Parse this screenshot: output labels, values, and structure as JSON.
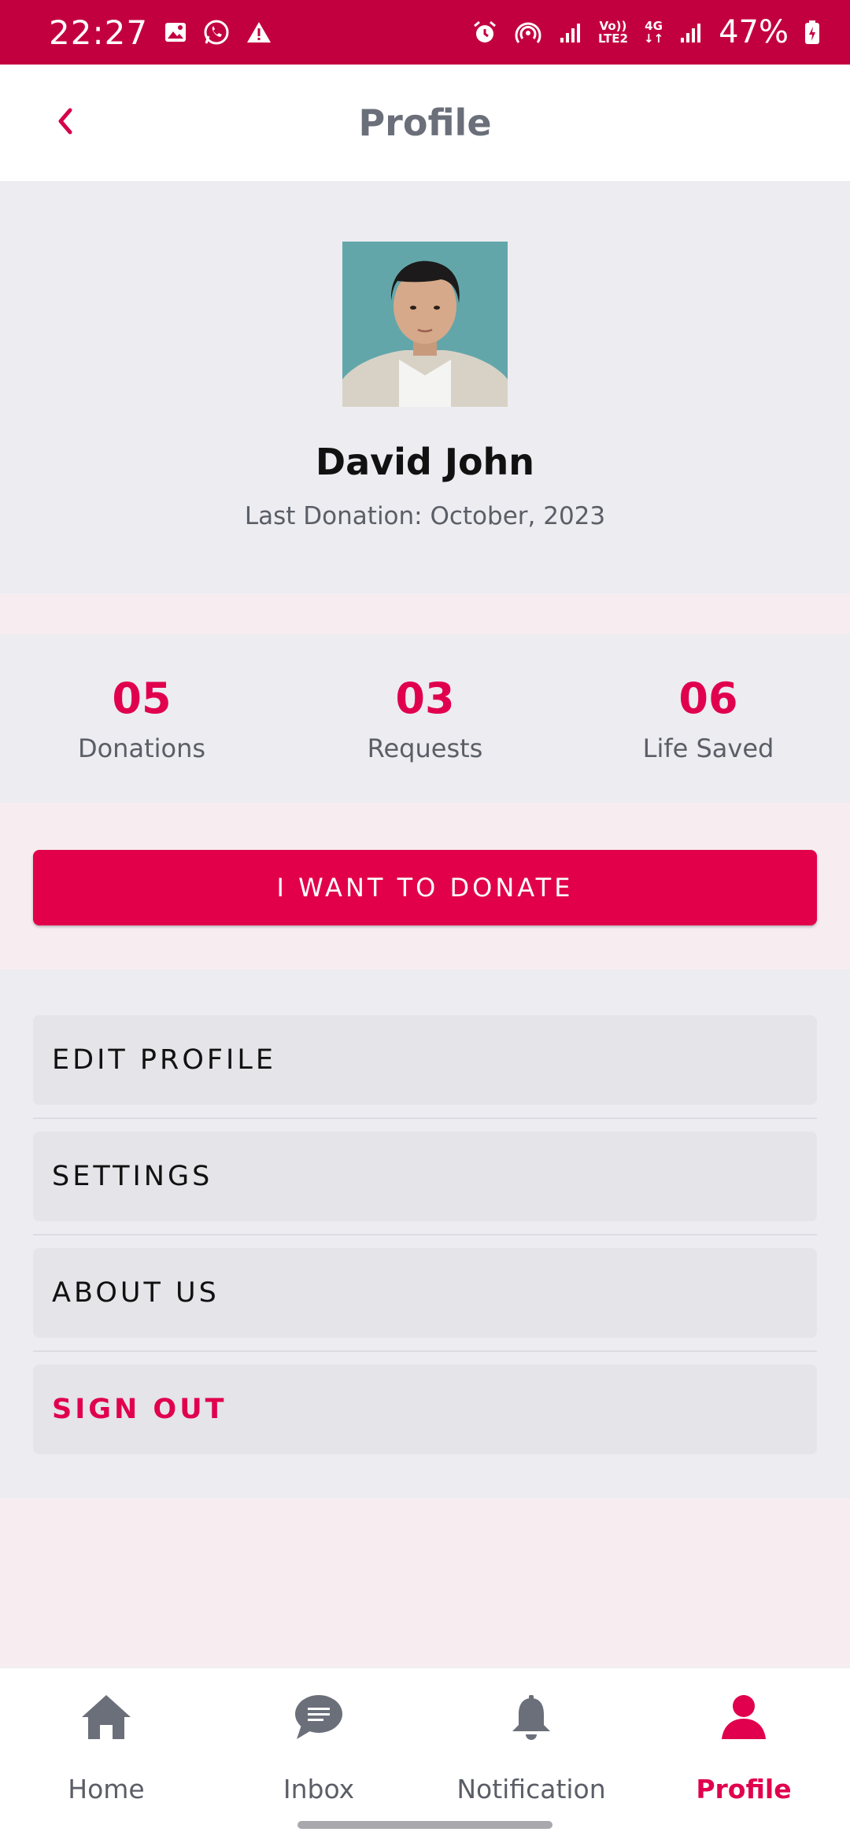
{
  "status_bar": {
    "time": "22:27",
    "network_top": "Vo))",
    "network_bottom": "LTE2",
    "net_type_top": "4G",
    "net_type_bottom": "↓↑",
    "battery": "47%",
    "icons": [
      "image-icon",
      "whatsapp-icon",
      "warning-icon",
      "alarm-icon",
      "hotspot-icon",
      "signal-icon",
      "signal-icon",
      "battery-icon"
    ]
  },
  "header": {
    "title": "Profile"
  },
  "profile": {
    "name": "David John",
    "last_donation": "Last Donation: October, 2023"
  },
  "stats": [
    {
      "value": "05",
      "label": "Donations"
    },
    {
      "value": "03",
      "label": "Requests"
    },
    {
      "value": "06",
      "label": "Life Saved"
    }
  ],
  "donate_button": "I WANT TO DONATE",
  "menu": [
    {
      "label": "EDIT PROFILE"
    },
    {
      "label": "SETTINGS"
    },
    {
      "label": "ABOUT US"
    },
    {
      "label": "SIGN OUT"
    }
  ],
  "bottom_nav": [
    {
      "label": "Home",
      "icon": "home-icon",
      "active": false
    },
    {
      "label": "Inbox",
      "icon": "chat-icon",
      "active": false
    },
    {
      "label": "Notification",
      "icon": "bell-icon",
      "active": false
    },
    {
      "label": "Profile",
      "icon": "person-icon",
      "active": true
    }
  ],
  "colors": {
    "accent": "#e0004d",
    "status_bar": "#c3003f",
    "inactive_icon": "#6b6f7a"
  }
}
